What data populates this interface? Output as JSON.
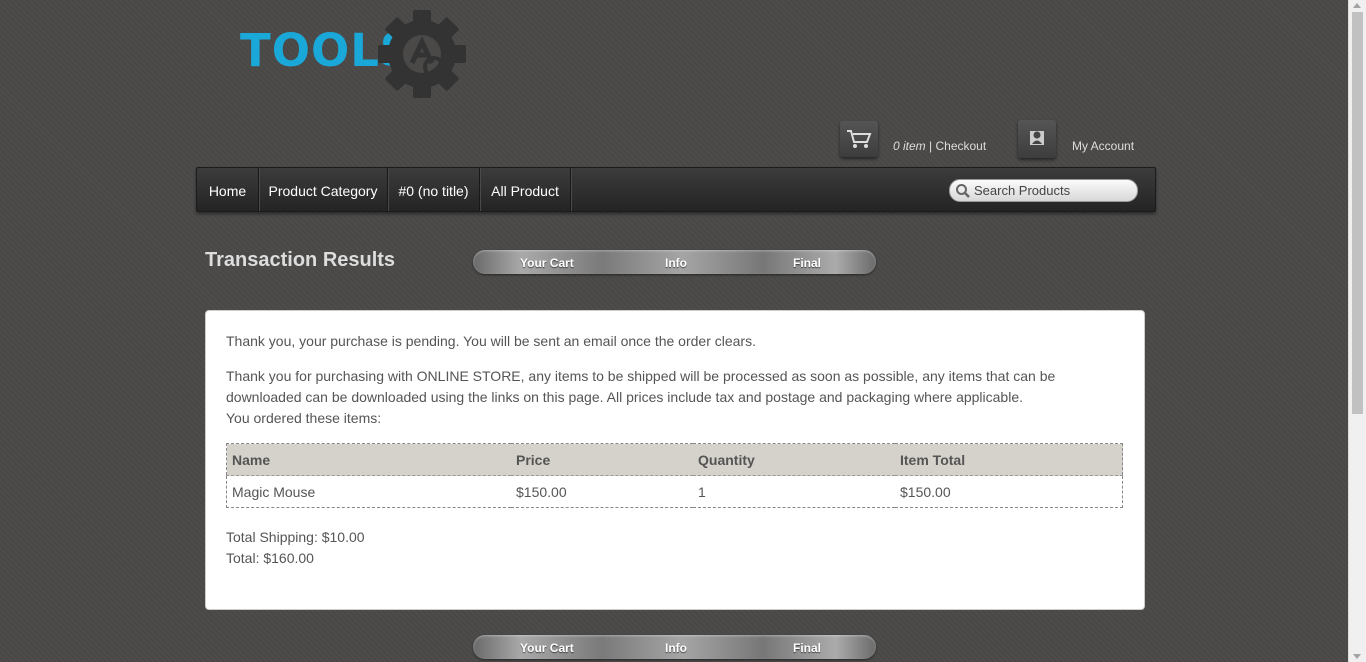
{
  "logo": {
    "text": "TOOLS",
    "emblem_letter": "A"
  },
  "header": {
    "cart_count": "0 item",
    "cart_separator": " | ",
    "checkout_label": "Checkout",
    "account_label": "My Account"
  },
  "nav": {
    "items": [
      {
        "label": "Home"
      },
      {
        "label": "Product Category"
      },
      {
        "label": "#0 (no title)"
      },
      {
        "label": "All Product"
      }
    ],
    "search_placeholder": "Search Products"
  },
  "page": {
    "title": "Transaction Results",
    "steps": [
      "Your Cart",
      "Info",
      "Final"
    ]
  },
  "results": {
    "pending_message": "Thank you, your purchase is pending. You will be sent an email once the order clears.",
    "thanks_message": "Thank you for purchasing with ONLINE STORE, any items to be shipped will be processed as soon as possible, any items that can be downloaded can be downloaded using the links on this page. All prices include tax and postage and packaging where applicable.",
    "ordered_intro": "You ordered these items:",
    "table": {
      "headers": [
        "Name",
        "Price",
        "Quantity",
        "Item Total"
      ],
      "rows": [
        [
          "Magic Mouse",
          "$150.00",
          "1",
          "$150.00"
        ]
      ]
    },
    "total_shipping": "Total Shipping: $10.00",
    "total": "Total: $160.00"
  },
  "colors": {
    "brand_blue": "#1aa8d8",
    "background": "#4a4948",
    "table_header": "#d5d1cb"
  },
  "icons": [
    "gear-logo-icon",
    "shopping-cart-icon",
    "user-icon",
    "search-icon"
  ]
}
